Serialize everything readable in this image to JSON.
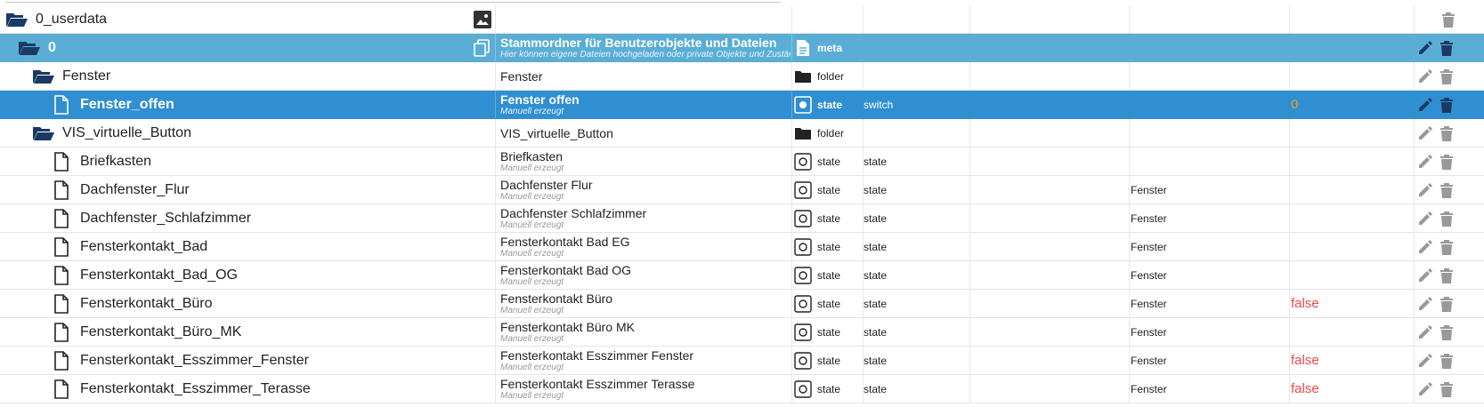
{
  "rows": [
    {
      "name": "0_userdata",
      "desc1": "",
      "desc2": "",
      "type": "",
      "role": "",
      "room": "",
      "value": ""
    },
    {
      "name": "0",
      "desc1": "Stammordner für Benutzerobjekte und Dateien",
      "desc2": "Hier können eigene Dateien hochgeladen oder private Objekte und Zustän",
      "type": "meta",
      "role": "",
      "room": "",
      "value": ""
    },
    {
      "name": "Fenster",
      "desc1": "Fenster",
      "desc2": "",
      "type": "folder",
      "role": "",
      "room": "",
      "value": ""
    },
    {
      "name": "Fenster_offen",
      "desc1": "Fenster offen",
      "desc2": "Manuell erzeugt",
      "type": "state",
      "role": "switch",
      "room": "",
      "value": "0"
    },
    {
      "name": "VIS_virtuelle_Button",
      "desc1": "VIS_virtuelle_Button",
      "desc2": "",
      "type": "folder",
      "role": "",
      "room": "",
      "value": ""
    },
    {
      "name": "Briefkasten",
      "desc1": "Briefkasten",
      "desc2": "Manuell erzeugt",
      "type": "state",
      "role": "state",
      "room": "",
      "value": ""
    },
    {
      "name": "Dachfenster_Flur",
      "desc1": "Dachfenster Flur",
      "desc2": "Manuell erzeugt",
      "type": "state",
      "role": "state",
      "room": "Fenster",
      "value": ""
    },
    {
      "name": "Dachfenster_Schlafzimmer",
      "desc1": "Dachfenster Schlafzimmer",
      "desc2": "Manuell erzeugt",
      "type": "state",
      "role": "state",
      "room": "Fenster",
      "value": ""
    },
    {
      "name": "Fensterkontakt_Bad",
      "desc1": "Fensterkontakt Bad EG",
      "desc2": "Manuell erzeugt",
      "type": "state",
      "role": "state",
      "room": "Fenster",
      "value": ""
    },
    {
      "name": "Fensterkontakt_Bad_OG",
      "desc1": "Fensterkontakt Bad OG",
      "desc2": "Manuell erzeugt",
      "type": "state",
      "role": "state",
      "room": "Fenster",
      "value": ""
    },
    {
      "name": "Fensterkontakt_Büro",
      "desc1": "Fensterkontakt Büro",
      "desc2": "Manuell erzeugt",
      "type": "state",
      "role": "state",
      "room": "Fenster",
      "value": "false"
    },
    {
      "name": "Fensterkontakt_Büro_MK",
      "desc1": "Fensterkontakt Büro MK",
      "desc2": "Manuell erzeugt",
      "type": "state",
      "role": "state",
      "room": "Fenster",
      "value": ""
    },
    {
      "name": "Fensterkontakt_Esszimmer_Fenster",
      "desc1": "Fensterkontakt Esszimmer Fenster",
      "desc2": "Manuell erzeugt",
      "type": "state",
      "role": "state",
      "room": "Fenster",
      "value": "false"
    },
    {
      "name": "Fensterkontakt_Esszimmer_Terasse",
      "desc1": "Fensterkontakt Esszimmer Terasse",
      "desc2": "Manuell erzeugt",
      "type": "state",
      "role": "state",
      "room": "Fenster",
      "value": "false"
    }
  ],
  "colors": {
    "selected_light": "#5aaed6",
    "selected_dark": "#2f8fd1",
    "value_orange": "#f0a020",
    "value_red": "#e84a4a"
  },
  "icons": {
    "folder_open": "folder-open-icon",
    "file": "file-icon",
    "copy": "copy-icon",
    "image": "image-icon",
    "meta": "meta-icon",
    "folder": "folder-icon",
    "state": "state-icon",
    "edit": "edit-icon",
    "delete": "delete-icon"
  }
}
